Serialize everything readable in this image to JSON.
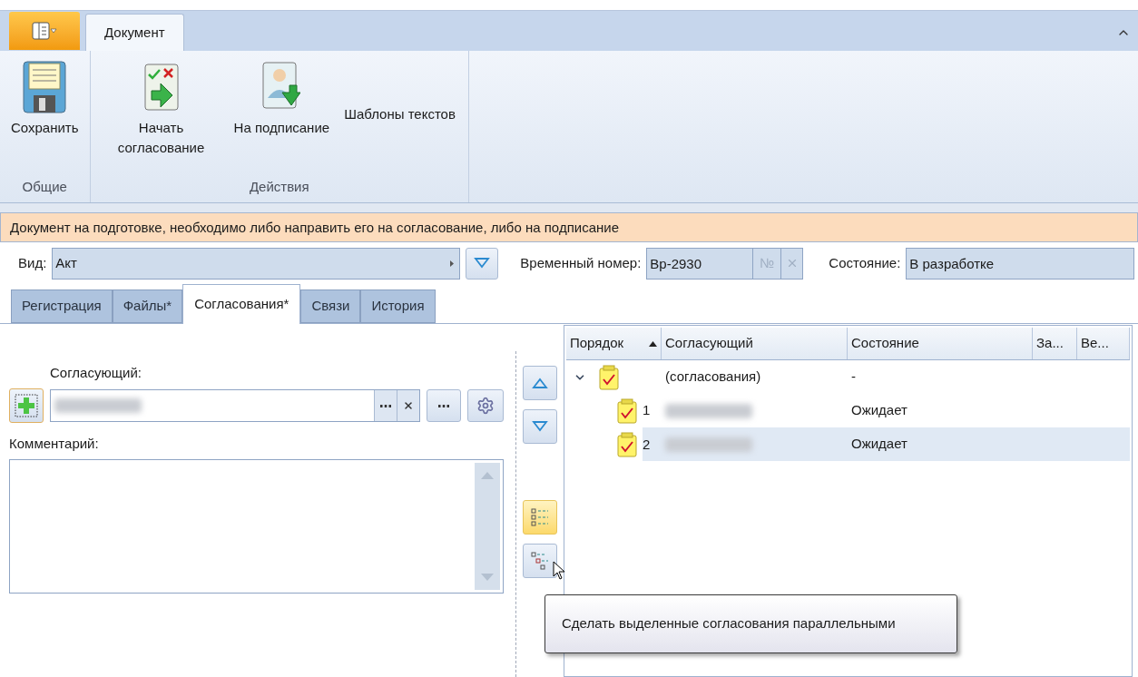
{
  "ribbon": {
    "tabs": [
      {
        "label": "Документ",
        "selected": true
      }
    ],
    "groups": [
      {
        "label": "Общие",
        "items": [
          {
            "label": "Сохранить",
            "kind": "save"
          }
        ]
      },
      {
        "label": "Действия",
        "items": [
          {
            "label": "Начать согласование",
            "kind": "start"
          },
          {
            "label": "На подписание",
            "kind": "sign"
          },
          {
            "label": "Шаблоны текстов",
            "kind": "text"
          }
        ]
      }
    ]
  },
  "info_bar": "Документ на подготовке, необходимо либо направить его на согласование, либо на подписание",
  "fields": {
    "kind": {
      "label": "Вид:",
      "value": "Акт"
    },
    "temp_number": {
      "label": "Временный номер:",
      "value": "Вр-2930",
      "number_button": "№"
    },
    "state": {
      "label": "Состояние:",
      "value": "В разработке"
    }
  },
  "doc_tabs": [
    {
      "label": "Регистрация",
      "selected": false
    },
    {
      "label": "Файлы*",
      "selected": false
    },
    {
      "label": "Согласования*",
      "selected": true
    },
    {
      "label": "Связи",
      "selected": false
    },
    {
      "label": "История",
      "selected": false
    }
  ],
  "approver_label": "Согласующий:",
  "comment_label": "Комментарий:",
  "side_buttons": [
    {
      "kind": "up",
      "highlighted": false
    },
    {
      "kind": "down",
      "highlighted": false
    },
    {
      "kind": "list",
      "highlighted": true
    },
    {
      "kind": "parallel",
      "highlighted": false
    }
  ],
  "grid": {
    "columns": [
      {
        "label": "Порядок",
        "sorted": true
      },
      {
        "label": "Согласующий",
        "sorted": false
      },
      {
        "label": "Состояние",
        "sorted": false
      },
      {
        "label": "За...",
        "sorted": false
      },
      {
        "label": "Ве..."
      }
    ],
    "rows": [
      {
        "approver": "(согласования)",
        "state": "-",
        "expanded": true,
        "selected": false,
        "children": [
          {
            "order": "1",
            "state": "Ожидает",
            "selected": false
          },
          {
            "order": "2",
            "state": "Ожидает",
            "selected": true
          }
        ]
      }
    ]
  },
  "tooltip": "Сделать выделенные согласования параллельными"
}
